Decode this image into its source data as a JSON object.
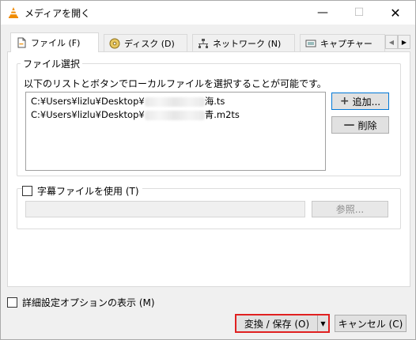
{
  "window": {
    "title": "メディアを開く",
    "minimize_glyph": "—",
    "maximize_glyph": "☐",
    "close_glyph": "✕"
  },
  "tabs": [
    {
      "label": "ファイル (F)",
      "icon": "file-icon",
      "active": true
    },
    {
      "label": "ディスク (D)",
      "icon": "disc-icon",
      "active": false
    },
    {
      "label": "ネットワーク (N)",
      "icon": "network-icon",
      "active": false
    },
    {
      "label": "キャプチャー",
      "icon": "capture-icon",
      "active": false
    }
  ],
  "tab_scroll": {
    "left": "◀",
    "right": "▶"
  },
  "file_selection": {
    "legend": "ファイル選択",
    "info": "以下のリストとボタンでローカルファイルを選択することが可能です。",
    "files": [
      {
        "prefix": "C:¥Users¥lizlu¥Desktop¥",
        "suffix": "海.ts"
      },
      {
        "prefix": "C:¥Users¥lizlu¥Desktop¥",
        "suffix": "青.m2ts"
      }
    ],
    "add_label": "追加...",
    "add_icon": "+",
    "remove_label": "削除",
    "remove_icon": "—"
  },
  "subtitle": {
    "checkbox_label": "字幕ファイルを使用 (T)",
    "checked": false,
    "path_value": "",
    "browse_label": "参照..."
  },
  "advanced": {
    "checkbox_label": "詳細設定オプションの表示 (M)",
    "checked": false
  },
  "footer": {
    "convert_label": "変換 / 保存 (O)",
    "dropdown_glyph": "▼",
    "cancel_label": "キャンセル (C)"
  },
  "colors": {
    "highlight_border": "#e02020",
    "focus_border": "#0078d7",
    "vlc_orange": "#f08c00"
  }
}
